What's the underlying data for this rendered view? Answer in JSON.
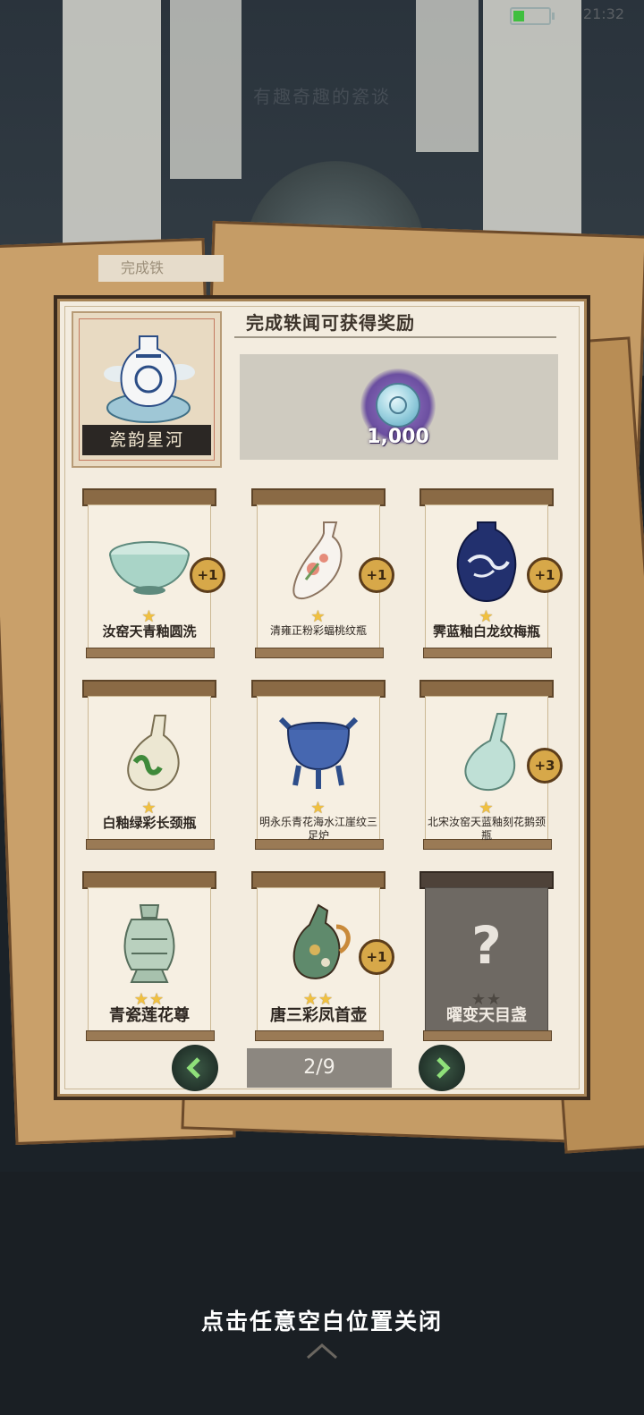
{
  "status_bar": {
    "time": "21:32",
    "battery_level": 0.35
  },
  "background": {
    "faded_title": "有趣奇趣的瓷谈",
    "back_card_text": "完成铁"
  },
  "panel": {
    "featured": {
      "label": "瓷韵星河"
    },
    "reward": {
      "title": "完成轶闻可获得奖励",
      "amount": "1,000"
    },
    "items": [
      {
        "name": "汝窑天青釉圆洗",
        "stars": "★",
        "badge": "+1"
      },
      {
        "name": "清雍正粉彩蝠桃纹瓶",
        "stars": "★",
        "badge": "+1"
      },
      {
        "name": "霁蓝釉白龙纹梅瓶",
        "stars": "★",
        "badge": "+1"
      },
      {
        "name": "白釉绿彩长颈瓶",
        "stars": "★",
        "badge": ""
      },
      {
        "name": "明永乐青花海水江崖纹三足炉",
        "stars": "★",
        "badge": ""
      },
      {
        "name": "北宋汝窑天蓝釉刻花鹅颈瓶",
        "stars": "★",
        "badge": "+3"
      },
      {
        "name": "青瓷莲花尊",
        "stars": "★★",
        "badge": ""
      },
      {
        "name": "唐三彩凤首壶",
        "stars": "★★",
        "badge": "+1"
      },
      {
        "name": "曜变天目盏",
        "stars": "★★",
        "badge": "",
        "locked": true
      }
    ],
    "pager": {
      "text": "2/9"
    }
  },
  "close_hint": "点击任意空白位置关闭"
}
